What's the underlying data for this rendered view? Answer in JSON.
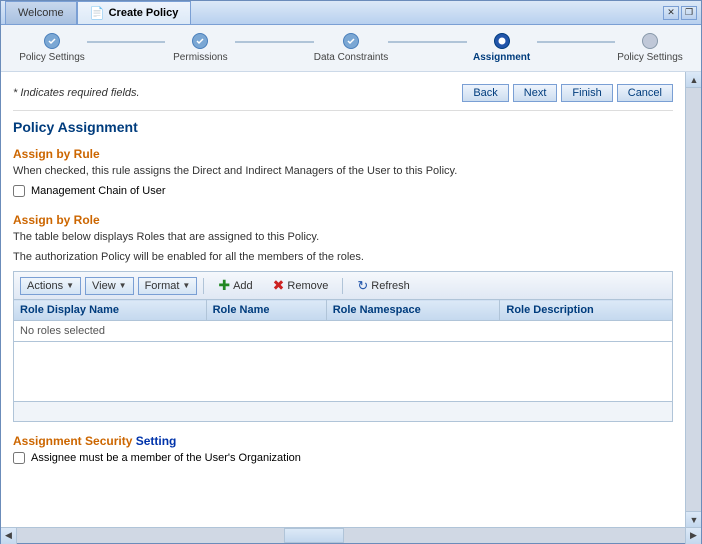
{
  "window": {
    "tabs": [
      {
        "id": "welcome",
        "label": "Welcome",
        "active": false
      },
      {
        "id": "create-policy",
        "label": "Create Policy",
        "active": true,
        "icon": "📄"
      }
    ],
    "close_label": "✕",
    "restore_label": "❐"
  },
  "wizard": {
    "steps": [
      {
        "id": "policy-settings",
        "label": "Policy Settings",
        "state": "done"
      },
      {
        "id": "permissions",
        "label": "Permissions",
        "state": "done"
      },
      {
        "id": "data-constraints",
        "label": "Data Constraints",
        "state": "done"
      },
      {
        "id": "assignment",
        "label": "Assignment",
        "state": "current"
      },
      {
        "id": "policy-settings-2",
        "label": "Policy Settings",
        "state": "todo"
      }
    ]
  },
  "navigation": {
    "required_text": "* Indicates required fields.",
    "back_label": "Back",
    "next_label": "Next",
    "finish_label": "Finish",
    "cancel_label": "Cancel"
  },
  "page": {
    "title": "Policy Assignment",
    "assign_by_rule": {
      "title": "Assign by Rule",
      "description": "When checked, this rule assigns the Direct and Indirect Managers of the User to this Policy.",
      "checkbox_label": "Management Chain of User"
    },
    "assign_by_role": {
      "title": "Assign by Role",
      "description1": "The table below displays Roles that are assigned to this Policy.",
      "description2": "The authorization Policy will be enabled for all the members of the roles."
    },
    "toolbar": {
      "actions_label": "Actions",
      "view_label": "View",
      "format_label": "Format",
      "add_label": "Add",
      "remove_label": "Remove",
      "refresh_label": "Refresh"
    },
    "table": {
      "columns": [
        {
          "id": "role-display-name",
          "label": "Role Display Name"
        },
        {
          "id": "role-name",
          "label": "Role Name"
        },
        {
          "id": "role-namespace",
          "label": "Role Namespace"
        },
        {
          "id": "role-description",
          "label": "Role Description"
        }
      ],
      "empty_message": "No roles selected"
    },
    "security": {
      "title_part1": "Assignment Security",
      "title_part2": "Setting",
      "checkbox_label": "Assignee must be a member of the User's Organization"
    }
  }
}
